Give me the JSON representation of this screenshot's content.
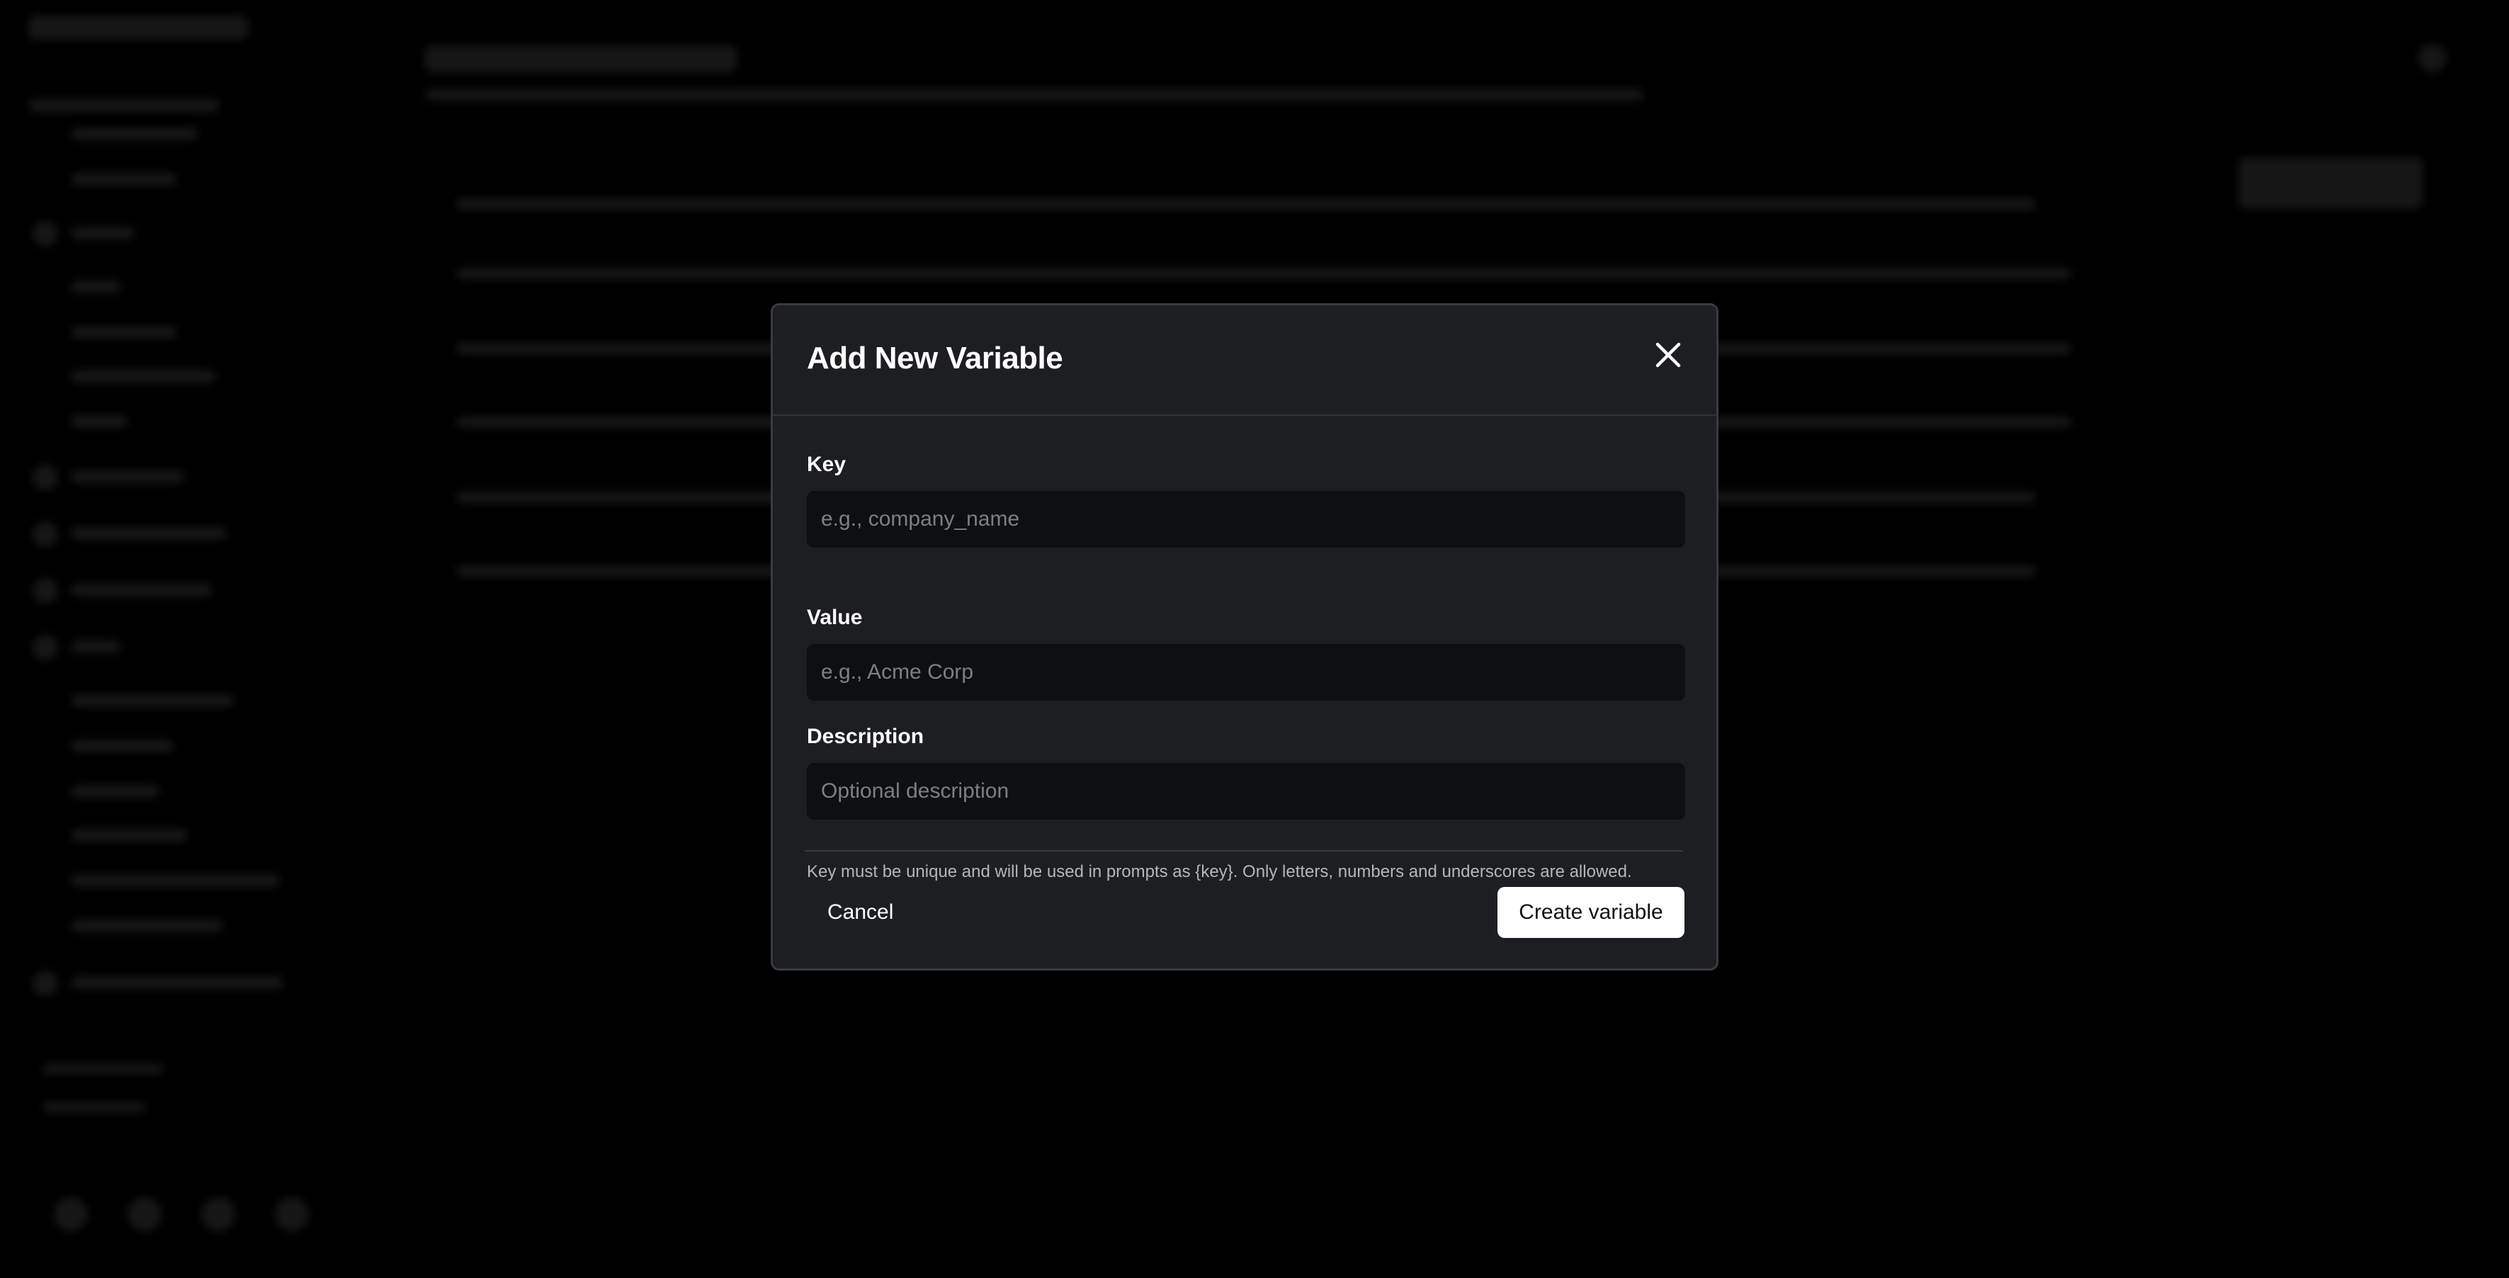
{
  "modal": {
    "title": "Add New Variable",
    "key": {
      "label": "Key",
      "placeholder": "e.g., company_name",
      "value": "",
      "help": "Key must be unique and will be used in prompts as {key}. Only letters, numbers and underscores are allowed."
    },
    "value": {
      "label": "Value",
      "placeholder": "e.g., Acme Corp",
      "value": ""
    },
    "description": {
      "label": "Description",
      "placeholder": "Optional description",
      "value": ""
    },
    "cancel_label": "Cancel",
    "create_label": "Create variable"
  },
  "icons": {
    "close": "close-icon"
  },
  "colors": {
    "overlay": "#000000",
    "modal_background": "#1d1e21",
    "modal_border": "#3a3b3f",
    "input_background": "#0e0f10",
    "primary_button": "#ffffff",
    "primary_button_text": "#111214"
  }
}
